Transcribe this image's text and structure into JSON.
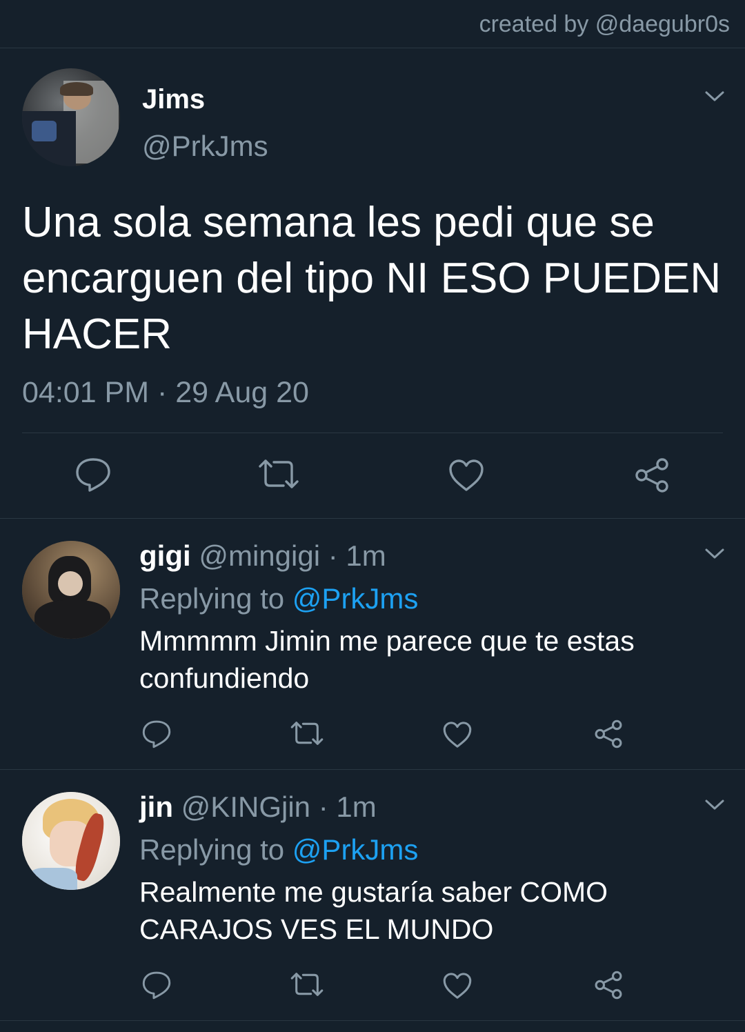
{
  "credit": "created by @daegubr0s",
  "main_tweet": {
    "name": "Jims",
    "handle": "@PrkJms",
    "text": "Una sola semana les pedi que se encarguen del tipo NI ESO PUEDEN HACER",
    "timestamp": "04:01 PM · 29 Aug 20"
  },
  "replies": [
    {
      "name": "gigi",
      "handle": "@mingigi",
      "time": "· 1m",
      "replying_label": "Replying to",
      "replying_to": "@PrkJms",
      "text": "Mmmmm Jimin me parece que te estas confundiendo"
    },
    {
      "name": "jin",
      "handle": "@KINGjin",
      "time": "· 1m",
      "replying_label": "Replying to",
      "replying_to": "@PrkJms",
      "text": "Realmente me gustaría saber COMO CARAJOS VES EL MUNDO"
    }
  ],
  "icons": [
    "chevron-down-icon",
    "reply-icon",
    "retweet-icon",
    "like-icon",
    "share-icon"
  ],
  "colors": {
    "background": "#15202b",
    "secondary_text": "#8899a6",
    "link": "#1da1f2",
    "divider": "#2a3742"
  }
}
